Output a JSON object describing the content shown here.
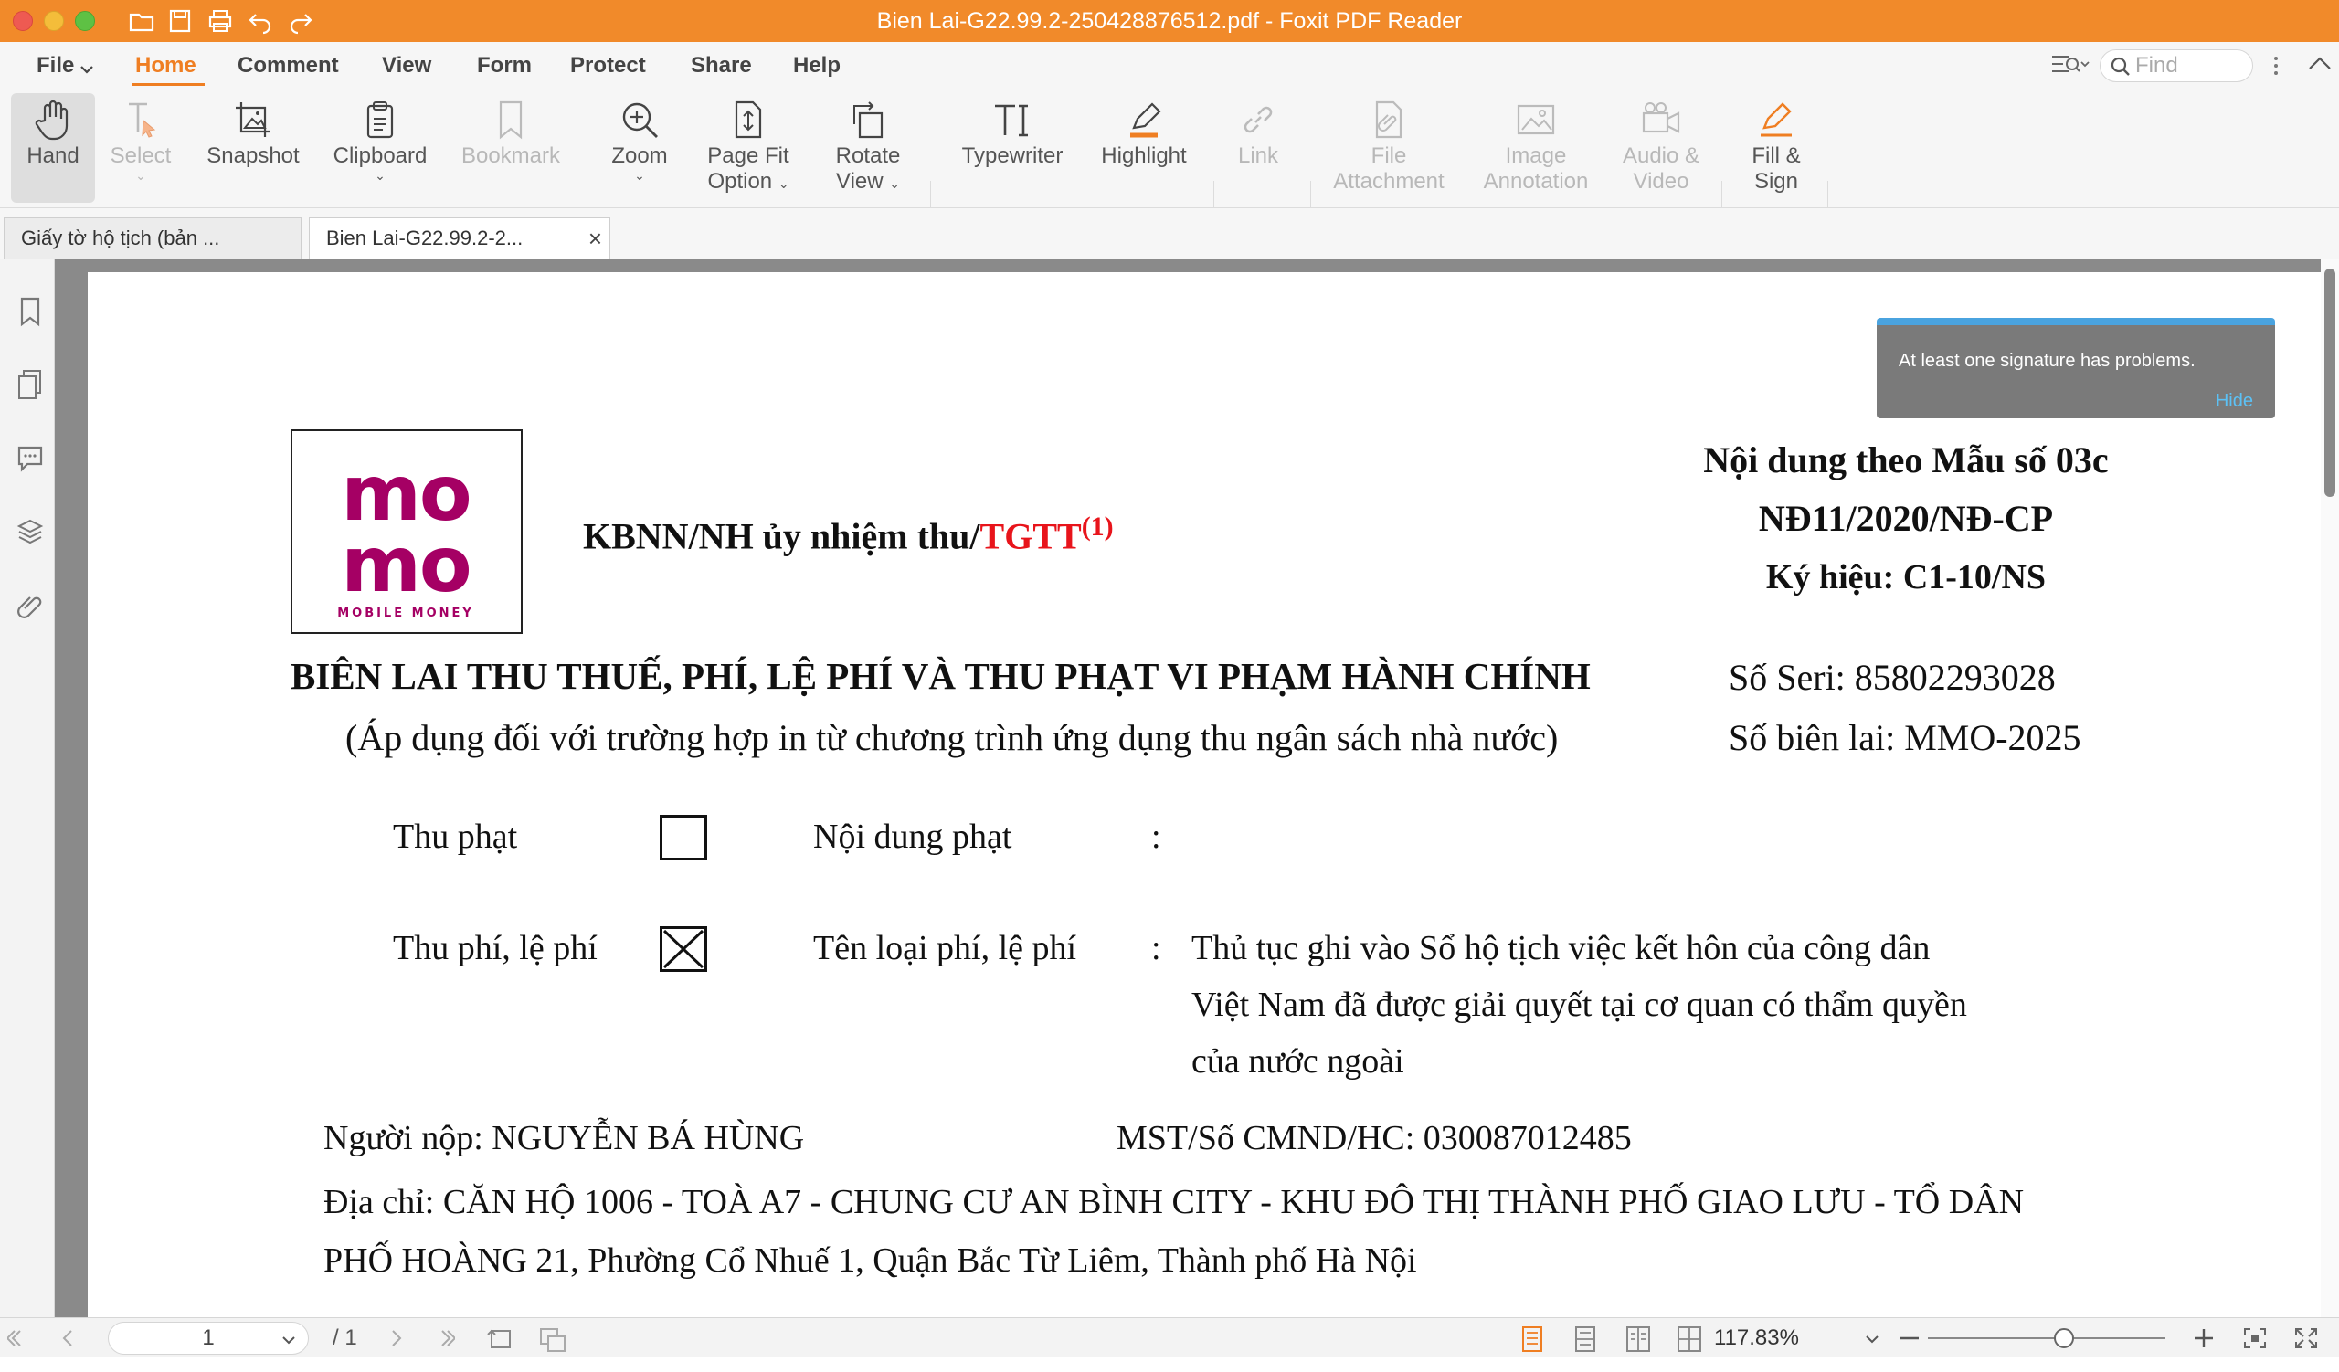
{
  "window": {
    "title": "Bien Lai-G22.99.2-250428876512.pdf - Foxit PDF Reader"
  },
  "menu": {
    "items": [
      "File",
      "Home",
      "Comment",
      "View",
      "Form",
      "Protect",
      "Share",
      "Help"
    ],
    "active": "Home",
    "find_placeholder": "Find"
  },
  "ribbon": {
    "hand": "Hand",
    "select": "Select",
    "snapshot": "Snapshot",
    "clipboard": "Clipboard",
    "bookmark": "Bookmark",
    "zoom": "Zoom",
    "page_fit_1": "Page Fit",
    "page_fit_2": "Option",
    "rotate_1": "Rotate",
    "rotate_2": "View",
    "typewriter": "Typewriter",
    "highlight": "Highlight",
    "link": "Link",
    "file_att_1": "File",
    "file_att_2": "Attachment",
    "image_ann_1": "Image",
    "image_ann_2": "Annotation",
    "audio_1": "Audio &",
    "audio_2": "Video",
    "fill_1": "Fill &",
    "fill_2": "Sign"
  },
  "tabs": [
    {
      "label": "Giấy tờ hộ tịch (bản ..."
    },
    {
      "label": "Bien Lai-G22.99.2-2..."
    }
  ],
  "notification": {
    "message": "At least one signature has problems.",
    "action": "Hide"
  },
  "document": {
    "logo_line1": "mo",
    "logo_line2": "mo",
    "logo_sub": "MOBILE MONEY",
    "header_left": "KBNN/NH ủy nhiệm thu/",
    "header_left_red": "TGTT",
    "header_left_sup": "(1)",
    "header_right_1": "Nội dung theo Mẫu số 03c",
    "header_right_2": "NĐ11/2020/NĐ-CP",
    "header_right_3": "Ký hiệu: C1-10/NS",
    "title": "BIÊN LAI THU THUẾ, PHÍ, LỆ PHÍ VÀ THU PHẠT VI PHẠM HÀNH CHÍNH",
    "subtitle": "(Áp dụng đối với trường hợp in từ chương trình ứng dụng thu ngân sách nhà nước)",
    "serial": "Số Seri: 85802293028",
    "receipt_no": "Số biên lai: MMO-2025",
    "row1_label": "Thu phạt",
    "row1_checked": false,
    "row1_field": "Nội dung phạt",
    "row1_colon": ":",
    "row2_label": "Thu phí, lệ phí",
    "row2_checked": true,
    "row2_field": "Tên loại phí, lệ phí",
    "row2_colon": ":",
    "row2_value_1": "Thủ tục ghi vào Sổ hộ tịch việc kết hôn của công dân",
    "row2_value_2": "Việt Nam đã được giải quyết tại cơ quan có thẩm quyền",
    "row2_value_3": "của nước ngoài",
    "payer": "Người nộp: NGUYỄN BÁ HÙNG",
    "tax_id": "MST/Số CMND/HC: 030087012485",
    "address_1": "Địa chỉ: CĂN HỘ 1006 - TOÀ A7 - CHUNG CƯ AN BÌNH CITY - KHU ĐÔ THỊ THÀNH PHỐ GIAO LƯU - TỔ DÂN",
    "address_2": "PHỐ HOÀNG 21, Phường Cổ Nhuế 1, Quận Bắc Từ Liêm, Thành phố Hà Nội"
  },
  "status": {
    "page_current": "1",
    "page_total": "/ 1",
    "zoom": "117.83%"
  },
  "colors": {
    "accent": "#ef7e22",
    "titlebar": "#f18a2a",
    "momo": "#a50064",
    "toast": "#7a7a7a",
    "red_text": "#e8141b"
  }
}
